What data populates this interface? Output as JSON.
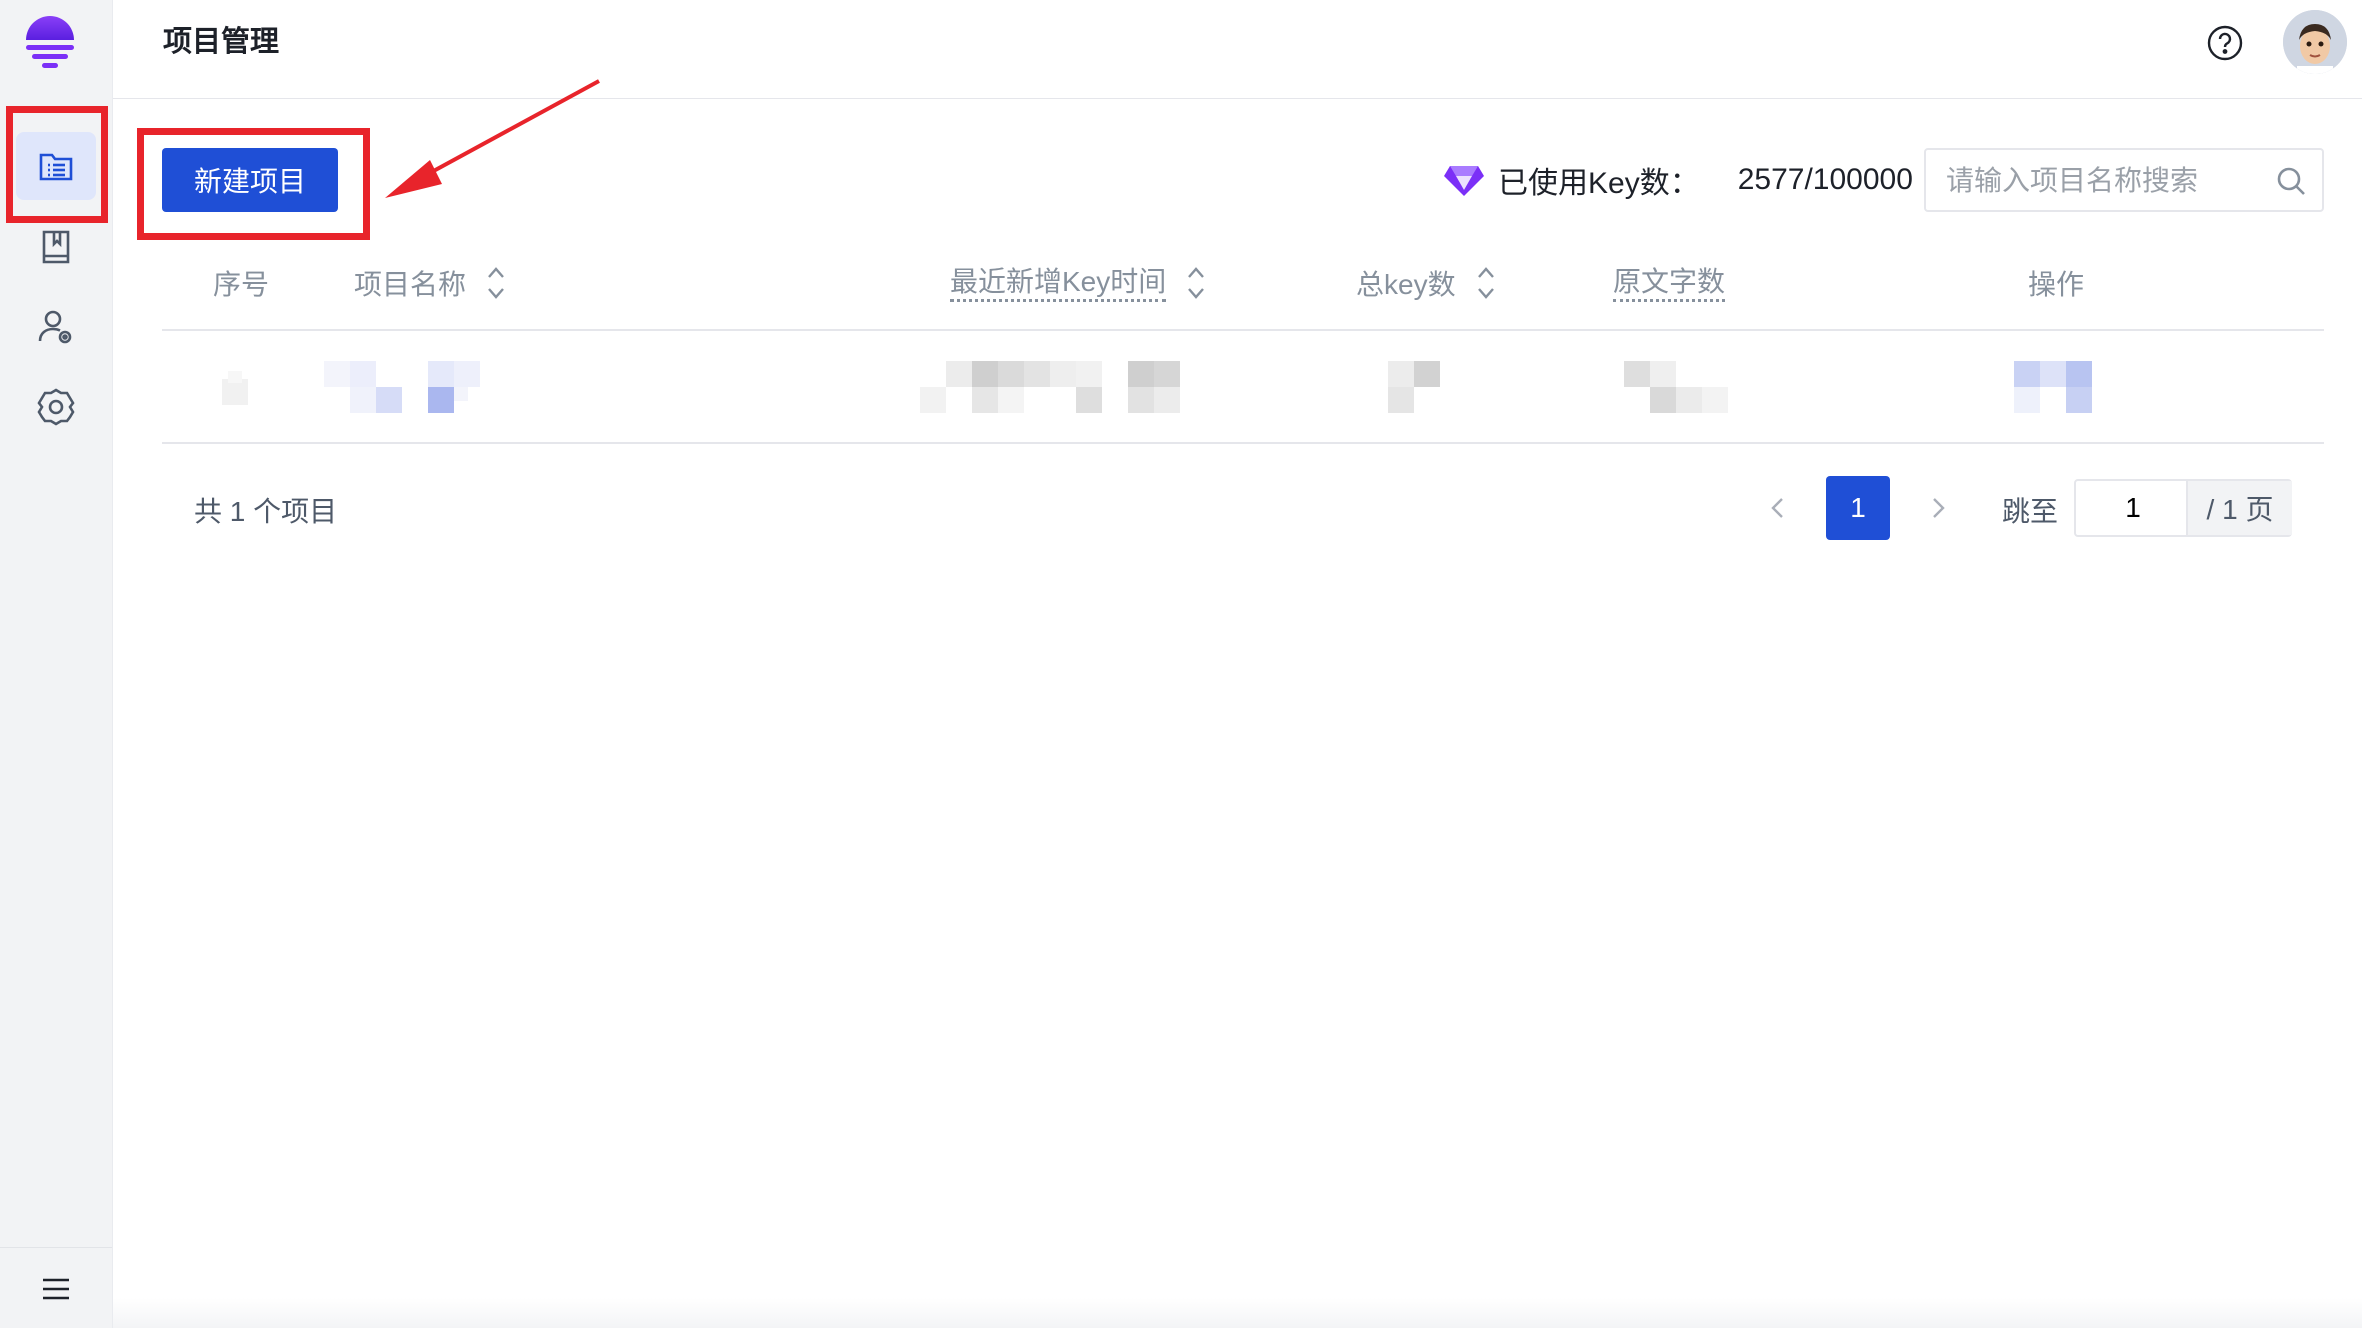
{
  "header": {
    "title": "项目管理"
  },
  "toolbar": {
    "new_project_label": "新建项目",
    "key_usage_label": "已使用Key数：",
    "key_usage_value": "2577/100000",
    "search_placeholder": "请输入项目名称搜索"
  },
  "table": {
    "columns": [
      {
        "label": "序号",
        "sortable": false
      },
      {
        "label": "项目名称",
        "sortable": true
      },
      {
        "label": "最近新增Key时间",
        "sortable": true,
        "tooltip": true
      },
      {
        "label": "总key数",
        "sortable": true
      },
      {
        "label": "原文字数",
        "sortable": false,
        "tooltip": true
      },
      {
        "label": "操作",
        "sortable": false
      }
    ],
    "rows_blurred": 1
  },
  "footer": {
    "total_text": "共 1 个项目",
    "current_page": "1",
    "jump_label": "跳至",
    "jump_value": "1",
    "page_suffix": "/ 1 页"
  },
  "sidebar": {
    "items": [
      {
        "name": "projects",
        "icon": "file-list-icon",
        "active": true
      },
      {
        "name": "docs",
        "icon": "book-icon",
        "active": false
      },
      {
        "name": "members",
        "icon": "user-settings-icon",
        "active": false
      },
      {
        "name": "settings",
        "icon": "gear-icon",
        "active": false
      }
    ]
  },
  "colors": {
    "primary": "#1f4fd6",
    "annotation_red": "#e8242b",
    "logo_purple": "#7b2ff7"
  }
}
